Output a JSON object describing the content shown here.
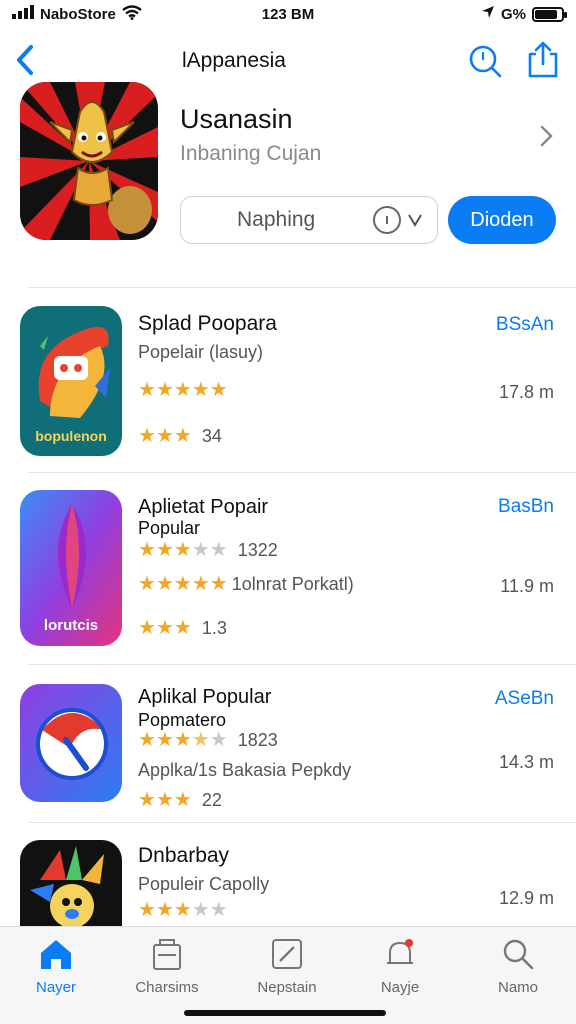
{
  "status": {
    "carrier": "NaboStore",
    "time": "123 BM",
    "battery": "G%",
    "battery_level": 0.85
  },
  "nav": {
    "title": "lAppanesia"
  },
  "featured": {
    "title": "Usanasin",
    "subtitle": "Inbaning Cujan",
    "select_label": "Naphing",
    "primary_button": "Dioden"
  },
  "apps": [
    {
      "name": "Splad Poopara",
      "subtitle": "Popelair (lasuy)",
      "action": "BSsAn",
      "size": "17.8 m",
      "rating_stars": 5,
      "meta": "",
      "rating2_stars": 3,
      "rating2_text": "34",
      "icon_caption": "bopulenon",
      "extra": ""
    },
    {
      "name": "Aplietat Popair",
      "subtitle": "Popular",
      "action": "BasBn",
      "size": "11.9 m",
      "rating_stars": 3,
      "meta": "1322",
      "rating2_stars": 5,
      "rating2_text": "1olnrat Porkatl)",
      "rating3_stars": 3,
      "rating3_text": "1.3",
      "icon_caption": "lorutcis",
      "extra": ""
    },
    {
      "name": "Aplikal Popular",
      "subtitle": "Popmatero",
      "action": "ASeBn",
      "size": "14.3 m",
      "rating_stars": 3,
      "meta": "1823",
      "extra": "Applka/1s Bakasia Pepkdy",
      "rating2_stars": 3,
      "rating2_text": "22"
    },
    {
      "name": "Dnbarbay",
      "subtitle": "Populeir Capolly",
      "action": "",
      "size": "12.9 m",
      "rating_stars": 3,
      "meta": ""
    }
  ],
  "tabs": [
    {
      "label": "Nayer",
      "icon": "home-icon",
      "active": true
    },
    {
      "label": "Charsims",
      "icon": "apps-icon",
      "active": false
    },
    {
      "label": "Nepstain",
      "icon": "edit-icon",
      "active": false
    },
    {
      "label": "Nayje",
      "icon": "bell-icon",
      "active": false
    },
    {
      "label": "Namo",
      "icon": "search-icon",
      "active": false
    }
  ],
  "colors": {
    "accent": "#0a7cf4",
    "star": "#f5a623"
  }
}
